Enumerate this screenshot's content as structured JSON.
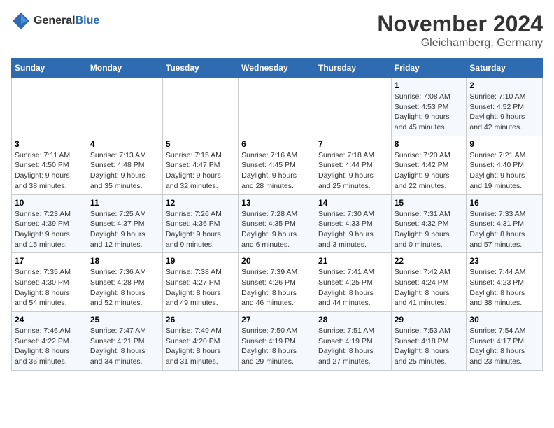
{
  "header": {
    "logo": {
      "general": "General",
      "blue": "Blue"
    },
    "title": "November 2024",
    "location": "Gleichamberg, Germany"
  },
  "weekdays": [
    "Sunday",
    "Monday",
    "Tuesday",
    "Wednesday",
    "Thursday",
    "Friday",
    "Saturday"
  ],
  "weeks": [
    [
      {
        "day": "",
        "info": ""
      },
      {
        "day": "",
        "info": ""
      },
      {
        "day": "",
        "info": ""
      },
      {
        "day": "",
        "info": ""
      },
      {
        "day": "",
        "info": ""
      },
      {
        "day": "1",
        "info": "Sunrise: 7:08 AM\nSunset: 4:53 PM\nDaylight: 9 hours\nand 45 minutes."
      },
      {
        "day": "2",
        "info": "Sunrise: 7:10 AM\nSunset: 4:52 PM\nDaylight: 9 hours\nand 42 minutes."
      }
    ],
    [
      {
        "day": "3",
        "info": "Sunrise: 7:11 AM\nSunset: 4:50 PM\nDaylight: 9 hours\nand 38 minutes."
      },
      {
        "day": "4",
        "info": "Sunrise: 7:13 AM\nSunset: 4:48 PM\nDaylight: 9 hours\nand 35 minutes."
      },
      {
        "day": "5",
        "info": "Sunrise: 7:15 AM\nSunset: 4:47 PM\nDaylight: 9 hours\nand 32 minutes."
      },
      {
        "day": "6",
        "info": "Sunrise: 7:16 AM\nSunset: 4:45 PM\nDaylight: 9 hours\nand 28 minutes."
      },
      {
        "day": "7",
        "info": "Sunrise: 7:18 AM\nSunset: 4:44 PM\nDaylight: 9 hours\nand 25 minutes."
      },
      {
        "day": "8",
        "info": "Sunrise: 7:20 AM\nSunset: 4:42 PM\nDaylight: 9 hours\nand 22 minutes."
      },
      {
        "day": "9",
        "info": "Sunrise: 7:21 AM\nSunset: 4:40 PM\nDaylight: 9 hours\nand 19 minutes."
      }
    ],
    [
      {
        "day": "10",
        "info": "Sunrise: 7:23 AM\nSunset: 4:39 PM\nDaylight: 9 hours\nand 15 minutes."
      },
      {
        "day": "11",
        "info": "Sunrise: 7:25 AM\nSunset: 4:37 PM\nDaylight: 9 hours\nand 12 minutes."
      },
      {
        "day": "12",
        "info": "Sunrise: 7:26 AM\nSunset: 4:36 PM\nDaylight: 9 hours\nand 9 minutes."
      },
      {
        "day": "13",
        "info": "Sunrise: 7:28 AM\nSunset: 4:35 PM\nDaylight: 9 hours\nand 6 minutes."
      },
      {
        "day": "14",
        "info": "Sunrise: 7:30 AM\nSunset: 4:33 PM\nDaylight: 9 hours\nand 3 minutes."
      },
      {
        "day": "15",
        "info": "Sunrise: 7:31 AM\nSunset: 4:32 PM\nDaylight: 9 hours\nand 0 minutes."
      },
      {
        "day": "16",
        "info": "Sunrise: 7:33 AM\nSunset: 4:31 PM\nDaylight: 8 hours\nand 57 minutes."
      }
    ],
    [
      {
        "day": "17",
        "info": "Sunrise: 7:35 AM\nSunset: 4:30 PM\nDaylight: 8 hours\nand 54 minutes."
      },
      {
        "day": "18",
        "info": "Sunrise: 7:36 AM\nSunset: 4:28 PM\nDaylight: 8 hours\nand 52 minutes."
      },
      {
        "day": "19",
        "info": "Sunrise: 7:38 AM\nSunset: 4:27 PM\nDaylight: 8 hours\nand 49 minutes."
      },
      {
        "day": "20",
        "info": "Sunrise: 7:39 AM\nSunset: 4:26 PM\nDaylight: 8 hours\nand 46 minutes."
      },
      {
        "day": "21",
        "info": "Sunrise: 7:41 AM\nSunset: 4:25 PM\nDaylight: 8 hours\nand 44 minutes."
      },
      {
        "day": "22",
        "info": "Sunrise: 7:42 AM\nSunset: 4:24 PM\nDaylight: 8 hours\nand 41 minutes."
      },
      {
        "day": "23",
        "info": "Sunrise: 7:44 AM\nSunset: 4:23 PM\nDaylight: 8 hours\nand 38 minutes."
      }
    ],
    [
      {
        "day": "24",
        "info": "Sunrise: 7:46 AM\nSunset: 4:22 PM\nDaylight: 8 hours\nand 36 minutes."
      },
      {
        "day": "25",
        "info": "Sunrise: 7:47 AM\nSunset: 4:21 PM\nDaylight: 8 hours\nand 34 minutes."
      },
      {
        "day": "26",
        "info": "Sunrise: 7:49 AM\nSunset: 4:20 PM\nDaylight: 8 hours\nand 31 minutes."
      },
      {
        "day": "27",
        "info": "Sunrise: 7:50 AM\nSunset: 4:19 PM\nDaylight: 8 hours\nand 29 minutes."
      },
      {
        "day": "28",
        "info": "Sunrise: 7:51 AM\nSunset: 4:19 PM\nDaylight: 8 hours\nand 27 minutes."
      },
      {
        "day": "29",
        "info": "Sunrise: 7:53 AM\nSunset: 4:18 PM\nDaylight: 8 hours\nand 25 minutes."
      },
      {
        "day": "30",
        "info": "Sunrise: 7:54 AM\nSunset: 4:17 PM\nDaylight: 8 hours\nand 23 minutes."
      }
    ]
  ]
}
